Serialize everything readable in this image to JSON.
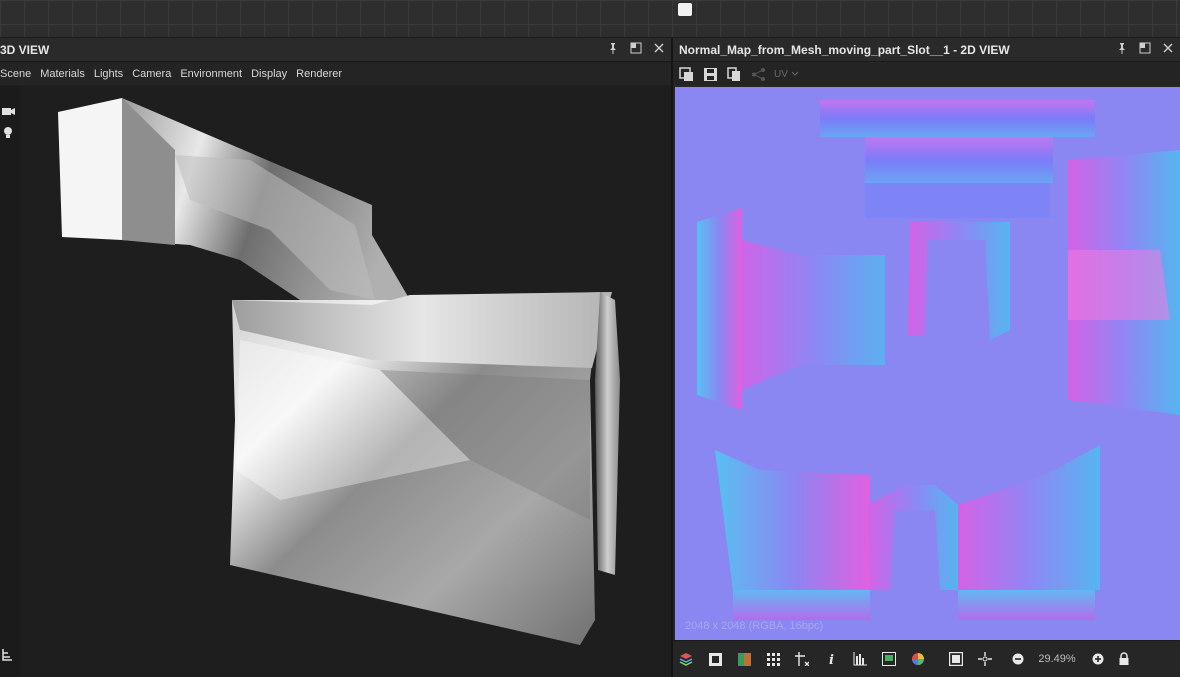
{
  "left_panel": {
    "title": "3D VIEW",
    "menu": [
      "Scene",
      "Materials",
      "Lights",
      "Camera",
      "Environment",
      "Display",
      "Renderer"
    ]
  },
  "right_panel": {
    "title": "Normal_Map_from_Mesh_moving_part_Slot__1 - 2D VIEW",
    "uv_label": "UV",
    "resolution_info": "2048 x 2048 (RGBA, 16bpc)",
    "zoom": "29.49%"
  },
  "icons": {
    "title_bar": [
      "pin-icon",
      "maximize-icon",
      "close-icon"
    ],
    "toolbar_2d": [
      "export-icon",
      "save-icon",
      "copy-icon",
      "share-icon"
    ],
    "status_bar": [
      "layers-icon",
      "checker-icon",
      "color-icon",
      "grid-icon",
      "tiling-icon",
      "info-icon",
      "histogram-icon",
      "view-icon",
      "color-wheel-icon",
      "fit-icon",
      "center-icon",
      "zoom-out-icon",
      "zoom-in-icon",
      "lock-icon"
    ]
  },
  "colors": {
    "normal_map_base": "#8a86f2",
    "panel_bg": "#1f1f1f",
    "title_bg": "#2a2a2a"
  }
}
